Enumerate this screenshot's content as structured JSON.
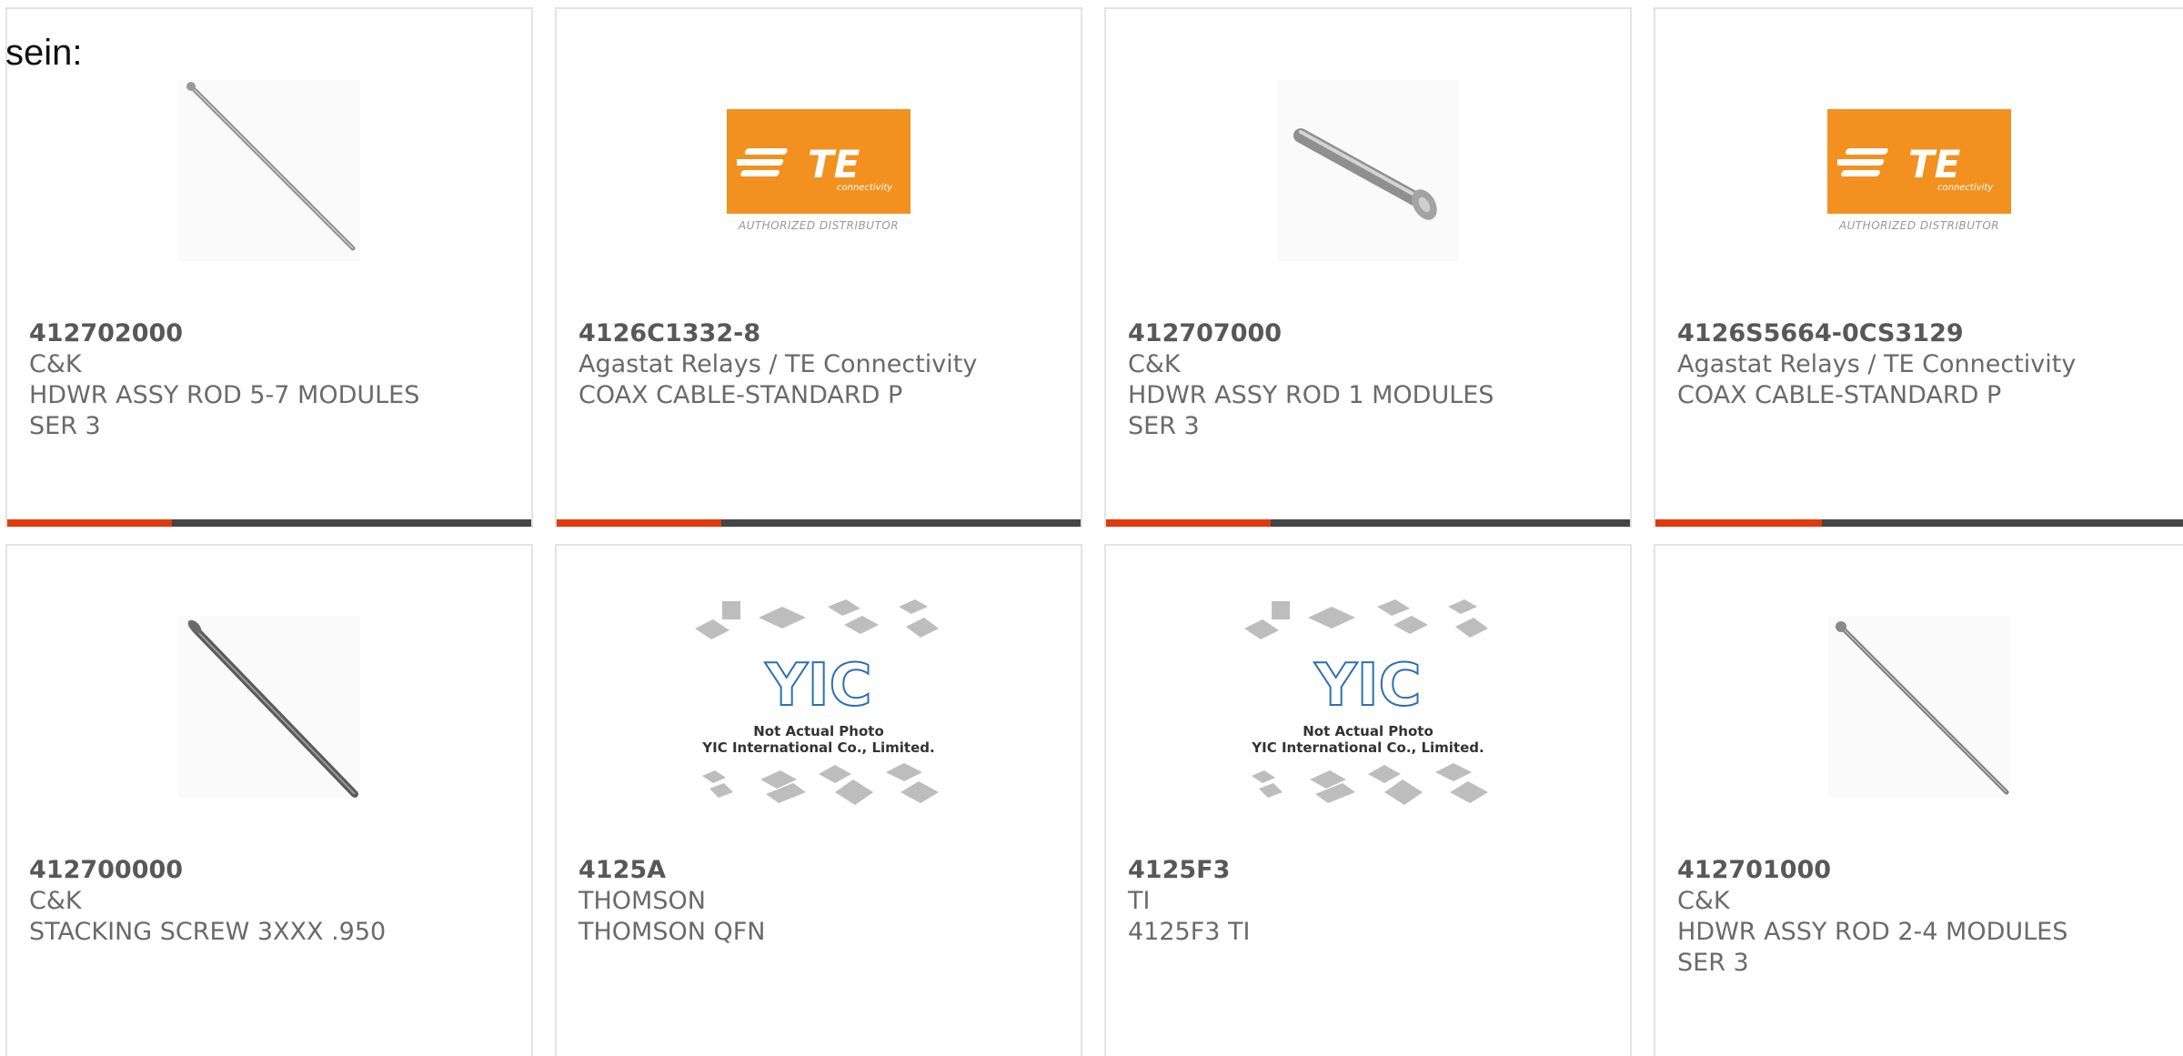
{
  "intro_text": "sein:",
  "colors": {
    "accent_bar": "#e03a0e",
    "dark_bar": "#454545",
    "te_orange": "#f2911f",
    "card_border": "#e3e3e3"
  },
  "cards": [
    {
      "part_number": "412702000",
      "manufacturer": "C&K",
      "description": "HDWR ASSY ROD 5-7 MODULES SER 3",
      "image": "hardware-rod-photo"
    },
    {
      "part_number": "4126C1332-8",
      "manufacturer": "Agastat Relays / TE Connectivity",
      "description": "COAX CABLE-STANDARD P",
      "image": "te-authorized-distributor-logo",
      "logo_text": "TE",
      "logo_sub": "connectivity",
      "logo_caption": "AUTHORIZED DISTRIBUTOR"
    },
    {
      "part_number": "412707000",
      "manufacturer": "C&K",
      "description": "HDWR ASSY ROD 1 MODULES SER 3",
      "image": "short-rod-photo"
    },
    {
      "part_number": "4126S5664-0CS3129",
      "manufacturer": "Agastat Relays / TE Connectivity",
      "description": "COAX CABLE-STANDARD P",
      "image": "te-authorized-distributor-logo",
      "logo_text": "TE",
      "logo_sub": "connectivity",
      "logo_caption": "AUTHORIZED DISTRIBUTOR"
    },
    {
      "part_number": "412700000",
      "manufacturer": "C&K",
      "description": "STACKING SCREW 3XXX .950",
      "image": "stacking-screw-photo"
    },
    {
      "part_number": "4125A",
      "manufacturer": "THOMSON",
      "description": "THOMSON QFN",
      "image": "yic-not-actual-photo",
      "logo_text": "YIC",
      "photo_line1": "Not Actual Photo",
      "photo_line2": "YIC International Co., Limited."
    },
    {
      "part_number": "4125F3",
      "manufacturer": "TI",
      "description": "4125F3 TI",
      "image": "yic-not-actual-photo",
      "logo_text": "YIC",
      "photo_line1": "Not Actual Photo",
      "photo_line2": "YIC International Co., Limited."
    },
    {
      "part_number": "412701000",
      "manufacturer": "C&K",
      "description": "HDWR ASSY ROD 2-4 MODULES SER 3",
      "image": "hardware-rod-photo"
    }
  ]
}
